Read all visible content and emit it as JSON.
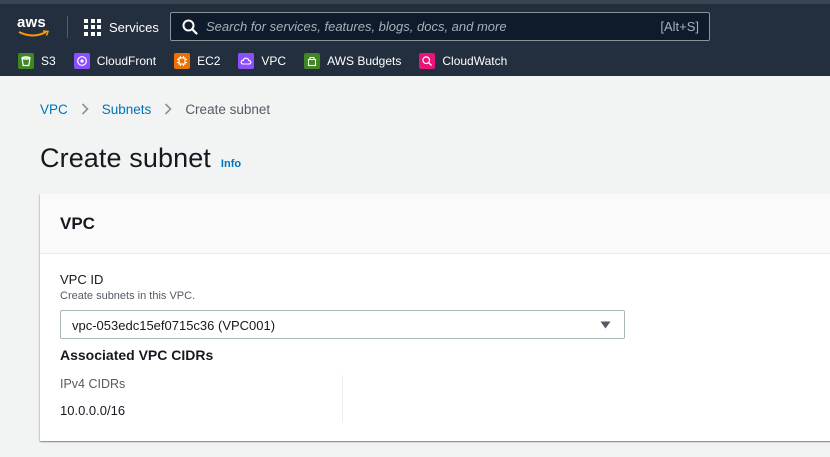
{
  "topbar": {
    "logo_text": "aws",
    "services_label": "Services",
    "search": {
      "placeholder": "Search for services, features, blogs, docs, and more",
      "shortcut": "[Alt+S]"
    },
    "favorites": [
      {
        "label": "S3",
        "color": "#3f8624",
        "icon": "s3-bucket-icon"
      },
      {
        "label": "CloudFront",
        "color": "#8c4fff",
        "icon": "cloudfront-icon"
      },
      {
        "label": "EC2",
        "color": "#ed7100",
        "icon": "ec2-chip-icon"
      },
      {
        "label": "VPC",
        "color": "#8c4fff",
        "icon": "vpc-cloud-icon"
      },
      {
        "label": "AWS Budgets",
        "color": "#3f8624",
        "icon": "budgets-icon"
      },
      {
        "label": "CloudWatch",
        "color": "#e7157b",
        "icon": "cloudwatch-icon"
      }
    ]
  },
  "breadcrumb": {
    "items": [
      "VPC",
      "Subnets"
    ],
    "current": "Create subnet"
  },
  "page": {
    "title": "Create subnet",
    "info": "Info"
  },
  "vpc_panel": {
    "title": "VPC",
    "vpc_id": {
      "label": "VPC ID",
      "description": "Create subnets in this VPC.",
      "selected": "vpc-053edc15ef0715c36 (VPC001)"
    },
    "cidrs_heading": "Associated VPC CIDRs",
    "ipv4_label": "IPv4 CIDRs",
    "ipv4_value": "10.0.0.0/16"
  }
}
